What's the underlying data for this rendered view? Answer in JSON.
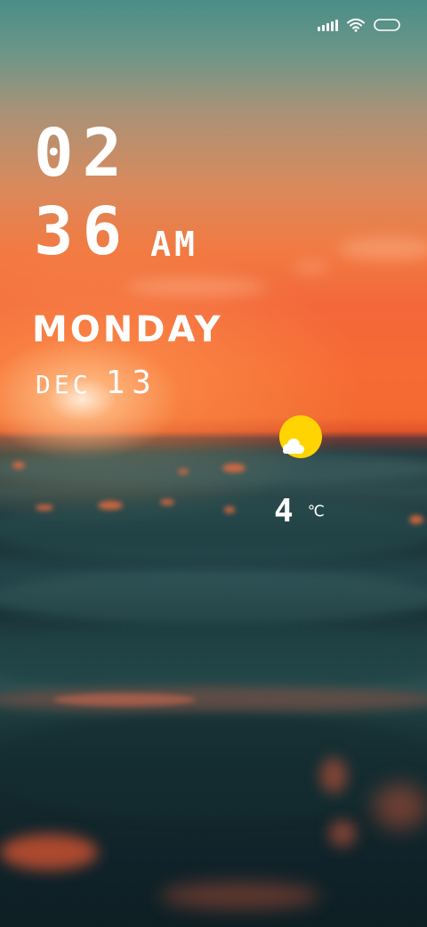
{
  "clock": {
    "hours": "02",
    "minutes": "36",
    "ampm": "AM"
  },
  "date": {
    "weekday": "MONDAY",
    "month": "DEC",
    "day": "13"
  },
  "weather": {
    "icon": "partly-sunny-icon",
    "temperature": "4",
    "unit": "℃",
    "sun_color": "#FFD400"
  },
  "status_bar": {
    "icons": [
      "signal-icon",
      "wifi-icon",
      "battery-icon"
    ]
  }
}
